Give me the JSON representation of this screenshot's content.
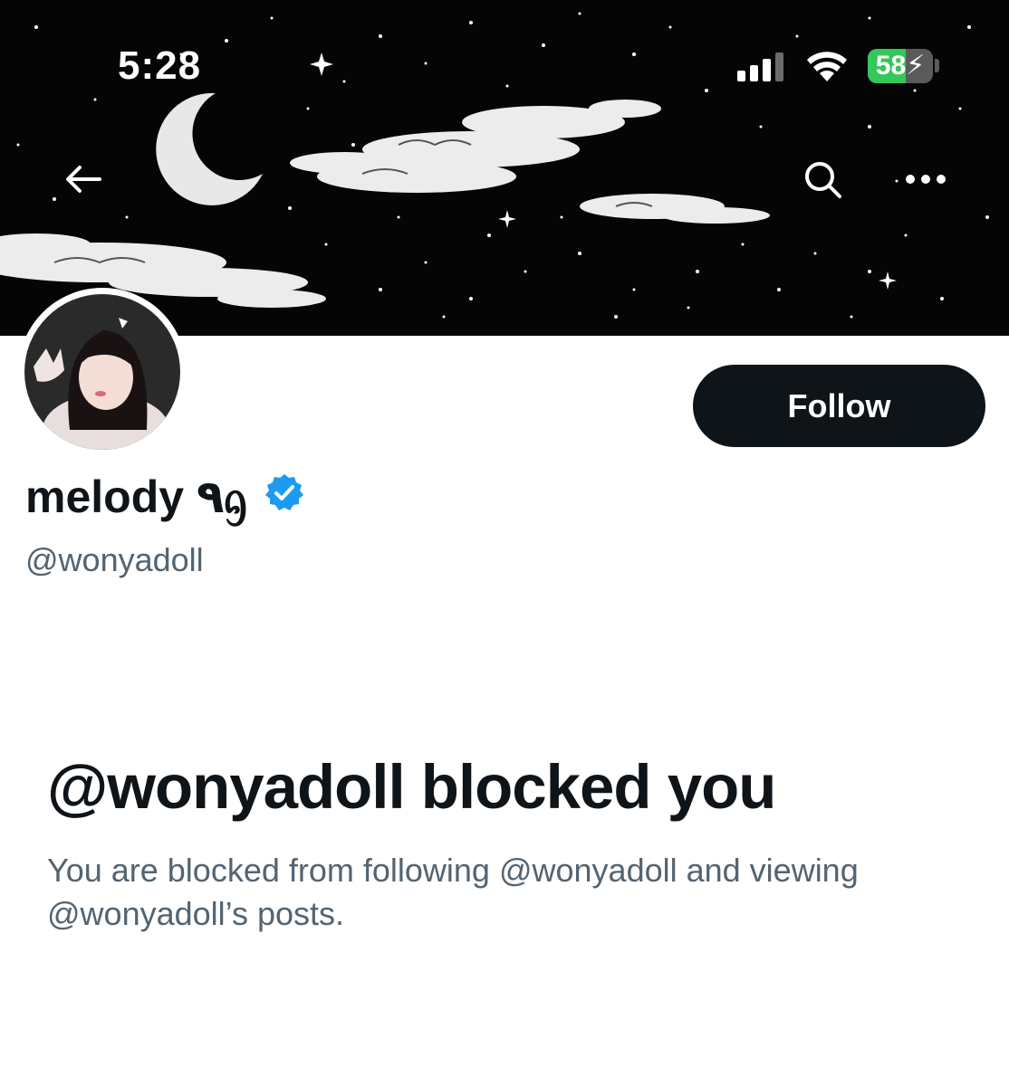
{
  "status_bar": {
    "time": "5:28",
    "battery_percent": "58",
    "battery_level": 0.58,
    "battery_charging": true,
    "battery_color": "#34c759"
  },
  "header": {
    "back_icon": "arrow-left-icon",
    "search_icon": "search-icon",
    "more_icon": "more-horizontal-icon"
  },
  "profile": {
    "follow_label": "Follow",
    "display_name": "melody ٩ᦇ",
    "verified": true,
    "verified_color": "#1d9bf0",
    "handle": "@wonyadoll"
  },
  "blocked": {
    "title": "@wonyadoll blocked you",
    "description": "You are blocked from following @wonyadoll and viewing @wonyadoll’s posts."
  },
  "colors": {
    "text_primary": "#0f1419",
    "text_secondary": "#536471",
    "button_dark": "#0f1419"
  }
}
